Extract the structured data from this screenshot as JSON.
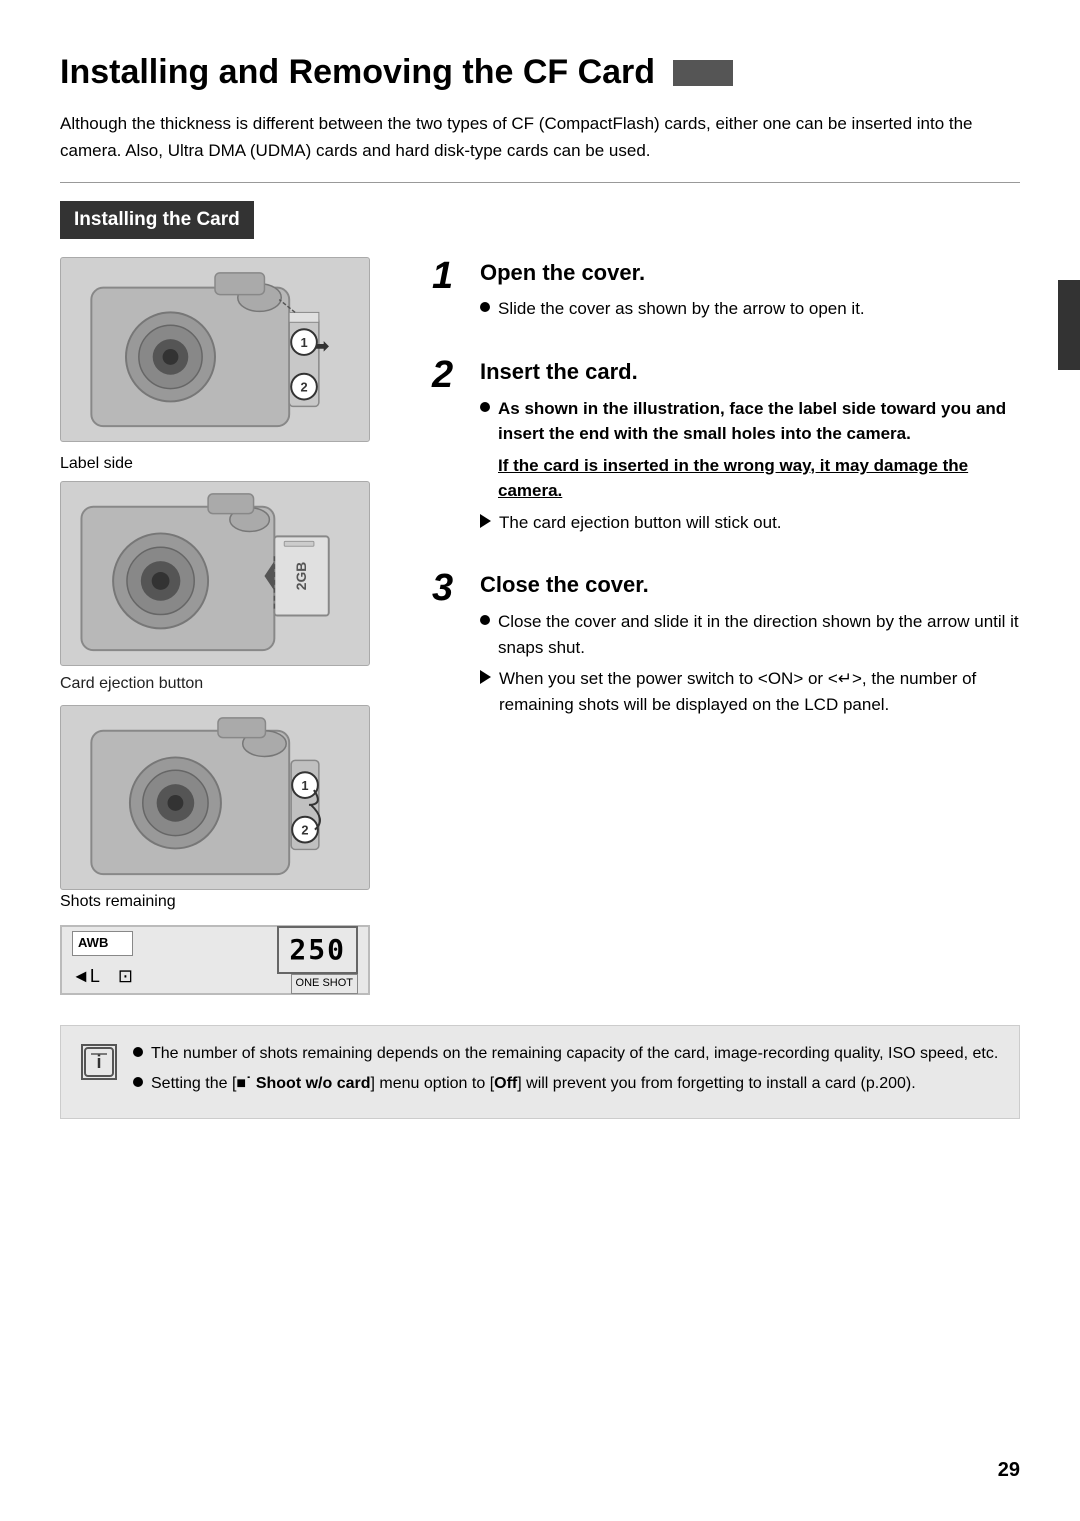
{
  "page": {
    "title": "Installing and Removing the CF Card",
    "page_number": "29",
    "intro": "Although the thickness is different between the two types of CF (CompactFlash) cards, either one can be inserted into the camera. Also, Ultra DMA (UDMA) cards and hard disk-type cards can be used.",
    "section_header": "Installing the Card",
    "right_tab_label": ""
  },
  "steps": [
    {
      "number": "1",
      "title": "Open the cover.",
      "bullets": [
        {
          "type": "circle",
          "text": "Slide the cover as shown by the arrow to open it."
        }
      ]
    },
    {
      "number": "2",
      "title": "Insert the card.",
      "bullets": [
        {
          "type": "circle",
          "bold": true,
          "text": "As shown in the illustration, face the label side toward you and insert the end with the small holes into the camera."
        },
        {
          "type": "warning",
          "text": "If the card is inserted in the wrong way, it may damage the camera."
        },
        {
          "type": "triangle",
          "text": "The card ejection button will stick out."
        }
      ]
    },
    {
      "number": "3",
      "title": "Close the cover.",
      "bullets": [
        {
          "type": "circle",
          "text": "Close the cover and slide it in the direction shown by the arrow until it snaps shut."
        },
        {
          "type": "triangle",
          "text": "When you set the power switch to <ON> or <↵>, the number of remaining shots will be displayed on the LCD panel."
        }
      ]
    }
  ],
  "captions": {
    "label_side": "Label side",
    "card_ejection": "Card ejection button",
    "shots_remaining": "Shots remaining"
  },
  "lcd": {
    "awb_label": "AWB",
    "number": "250",
    "oneshot": "ONE SHOT",
    "mode_icon": "◄L"
  },
  "note": {
    "icon": "i",
    "items": [
      "The number of shots remaining depends on the remaining capacity of the card, image-recording quality, ISO speed, etc.",
      "Setting the [■˙ Shoot w/o card] menu option to [Off] will prevent you from forgetting to install a card (p.200)."
    ]
  }
}
